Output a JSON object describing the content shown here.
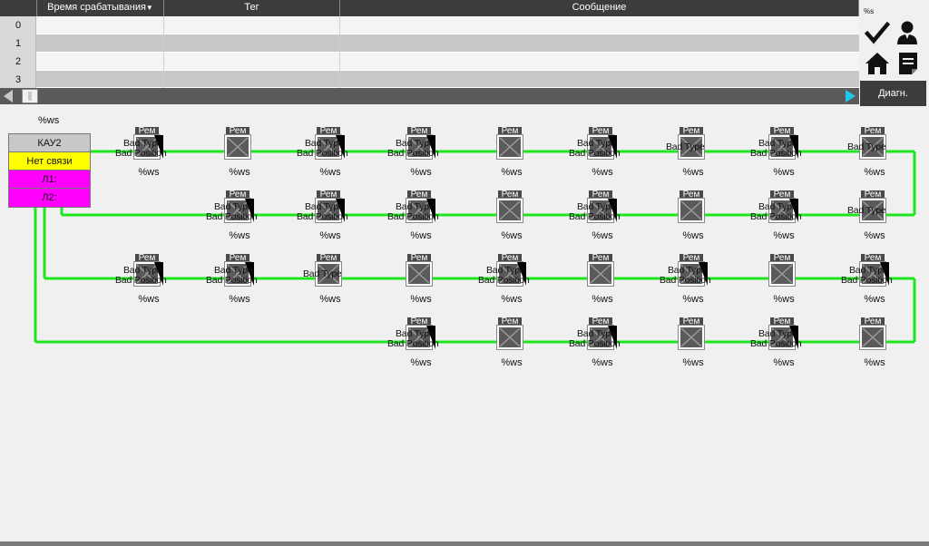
{
  "table": {
    "headers": [
      "",
      "Время срабатывания",
      "Тег",
      "Сообщение"
    ],
    "rows": [
      {
        "num": "0"
      },
      {
        "num": "1"
      },
      {
        "num": "2"
      },
      {
        "num": "3"
      }
    ]
  },
  "side": {
    "ws_label": "%s",
    "icons": [
      "checkmark-icon",
      "user-icon",
      "home-icon",
      "report-icon"
    ],
    "diag_label": "Диагн."
  },
  "controller": {
    "ws_label": "%ws",
    "name": "КАУ2",
    "state": "Нет связи",
    "line1": "Л1:",
    "line2": "Л2:"
  },
  "device_text": {
    "rem": "Рем",
    "bad_type": "Bad Type",
    "bad_position": "Bad Position",
    "ws": "%ws"
  },
  "colors": {
    "line": "#1ee61e",
    "state_no_link": "#ffff00",
    "line_status": "#ff00ff",
    "scroll_arrow": "#1ec8e6"
  },
  "devices": [
    {
      "row": 1,
      "col": 1,
      "status": "bad"
    },
    {
      "row": 1,
      "col": 2,
      "status": "normal"
    },
    {
      "row": 1,
      "col": 3,
      "status": "bad"
    },
    {
      "row": 1,
      "col": 4,
      "status": "bad"
    },
    {
      "row": 1,
      "col": 5,
      "status": "normal"
    },
    {
      "row": 1,
      "col": 6,
      "status": "bad"
    },
    {
      "row": 1,
      "col": 7,
      "status": "type"
    },
    {
      "row": 1,
      "col": 8,
      "status": "bad"
    },
    {
      "row": 1,
      "col": 9,
      "status": "type"
    },
    {
      "row": 2,
      "col": 2,
      "status": "bad"
    },
    {
      "row": 2,
      "col": 3,
      "status": "bad"
    },
    {
      "row": 2,
      "col": 4,
      "status": "bad"
    },
    {
      "row": 2,
      "col": 5,
      "status": "normal"
    },
    {
      "row": 2,
      "col": 6,
      "status": "bad"
    },
    {
      "row": 2,
      "col": 7,
      "status": "normal"
    },
    {
      "row": 2,
      "col": 8,
      "status": "bad"
    },
    {
      "row": 2,
      "col": 9,
      "status": "type"
    },
    {
      "row": 3,
      "col": 1,
      "status": "bad"
    },
    {
      "row": 3,
      "col": 2,
      "status": "bad"
    },
    {
      "row": 3,
      "col": 3,
      "status": "type"
    },
    {
      "row": 3,
      "col": 4,
      "status": "normal"
    },
    {
      "row": 3,
      "col": 5,
      "status": "bad"
    },
    {
      "row": 3,
      "col": 6,
      "status": "normal"
    },
    {
      "row": 3,
      "col": 7,
      "status": "bad"
    },
    {
      "row": 3,
      "col": 8,
      "status": "normal"
    },
    {
      "row": 3,
      "col": 9,
      "status": "bad"
    },
    {
      "row": 4,
      "col": 4,
      "status": "bad"
    },
    {
      "row": 4,
      "col": 5,
      "status": "normal"
    },
    {
      "row": 4,
      "col": 6,
      "status": "bad"
    },
    {
      "row": 4,
      "col": 7,
      "status": "normal"
    },
    {
      "row": 4,
      "col": 8,
      "status": "bad"
    },
    {
      "row": 4,
      "col": 9,
      "status": "normal"
    }
  ]
}
